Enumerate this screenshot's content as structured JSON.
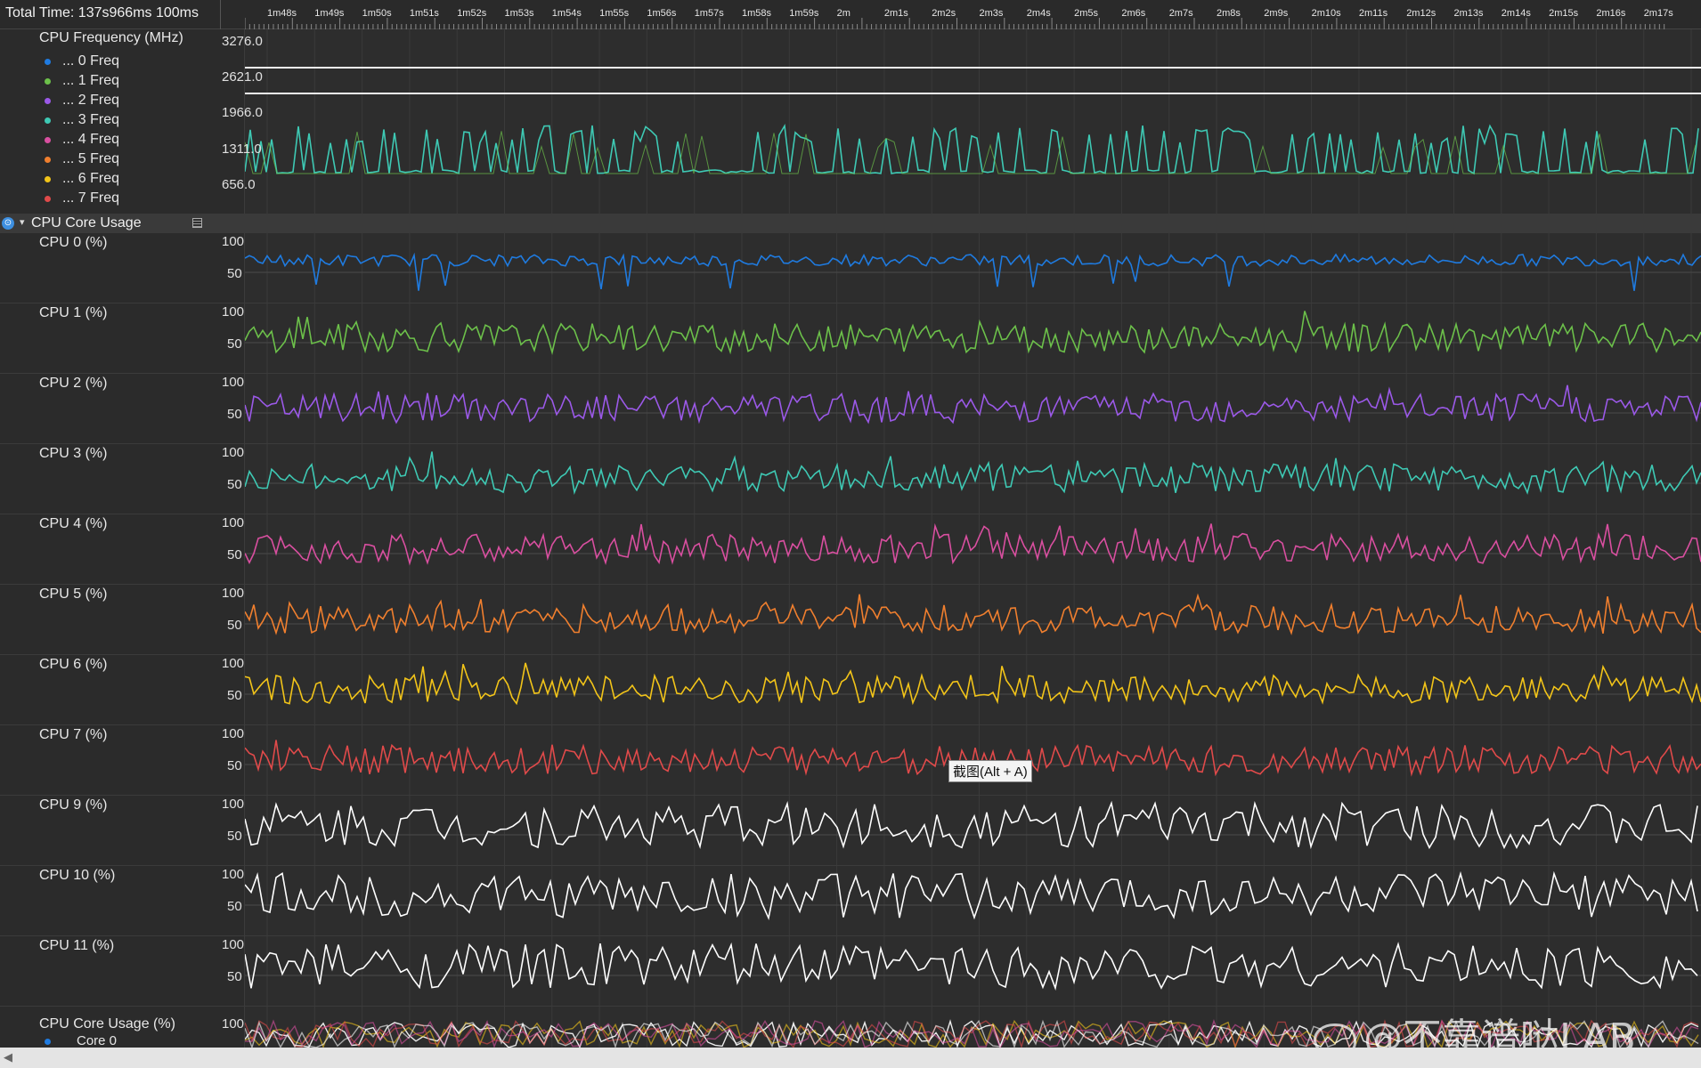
{
  "header": {
    "total_time": "Total Time: 137s966ms   100ms"
  },
  "ruler": {
    "ticks": [
      "1m48s",
      "1m49s",
      "1m50s",
      "1m51s",
      "1m52s",
      "1m53s",
      "1m54s",
      "1m55s",
      "1m56s",
      "1m57s",
      "1m58s",
      "1m59s",
      "2m",
      "2m1s",
      "2m2s",
      "2m3s",
      "2m4s",
      "2m5s",
      "2m6s",
      "2m7s",
      "2m8s",
      "2m9s",
      "2m10s",
      "2m11s",
      "2m12s",
      "2m13s",
      "2m14s",
      "2m15s",
      "2m16s",
      "2m17s"
    ]
  },
  "freq": {
    "title": "CPU Frequency (MHz)",
    "axis": [
      "3276.0",
      "2621.0",
      "1966.0",
      "1311.0",
      "656.0"
    ],
    "legend": [
      {
        "label": "... 0 Freq",
        "color": "#1f7be0"
      },
      {
        "label": "... 1 Freq",
        "color": "#6cc04a"
      },
      {
        "label": "... 2 Freq",
        "color": "#9b59e8"
      },
      {
        "label": "... 3 Freq",
        "color": "#3ec9b4"
      },
      {
        "label": "... 4 Freq",
        "color": "#d94fa0"
      },
      {
        "label": "... 5 Freq",
        "color": "#f07f2e"
      },
      {
        "label": "... 6 Freq",
        "color": "#f2c419"
      },
      {
        "label": "... 7 Freq",
        "color": "#e04a4a"
      }
    ]
  },
  "group": {
    "label": "CPU Core Usage",
    "icon": "info-icon"
  },
  "cores": [
    {
      "label": "CPU 0 (%)",
      "color": "#1f7be0"
    },
    {
      "label": "CPU 1 (%)",
      "color": "#6cc04a"
    },
    {
      "label": "CPU 2 (%)",
      "color": "#9b59e8"
    },
    {
      "label": "CPU 3 (%)",
      "color": "#3ec9b4"
    },
    {
      "label": "CPU 4 (%)",
      "color": "#d94fa0"
    },
    {
      "label": "CPU 5 (%)",
      "color": "#f07f2e"
    },
    {
      "label": "CPU 6 (%)",
      "color": "#f2c419"
    },
    {
      "label": "CPU 7 (%)",
      "color": "#e04a4a"
    },
    {
      "label": "CPU 9 (%)",
      "color": "#ffffff"
    },
    {
      "label": "CPU 10 (%)",
      "color": "#ffffff"
    },
    {
      "label": "CPU 11 (%)",
      "color": "#ffffff"
    }
  ],
  "core_axis": {
    "top": "100",
    "mid": "50"
  },
  "combined": {
    "label": "CPU Core Usage (%)",
    "legend_first": "Core 0",
    "axis_top": "100"
  },
  "tooltip": "截图(Alt + A)",
  "watermark": "@不靠谱哒LAB"
}
